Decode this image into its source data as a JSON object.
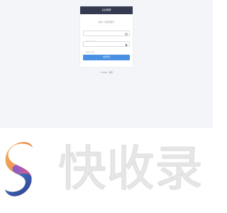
{
  "login": {
    "header_title": "后台管理",
    "subtitle": "您好！请登录账号",
    "username_placeholder": "请输入用户名",
    "password_placeholder": "请输入密码",
    "login_button": "立即登录",
    "copyright": "© 2020 · 管理"
  },
  "watermark": {
    "text": "快收录"
  },
  "colors": {
    "page_background": "#f4f5f9",
    "header_background": "#343a4f",
    "button_primary": "#4a90e2"
  },
  "icons": {
    "username": "user-icon",
    "password": "lock-icon",
    "watermark_logo": "s-logo-icon"
  }
}
